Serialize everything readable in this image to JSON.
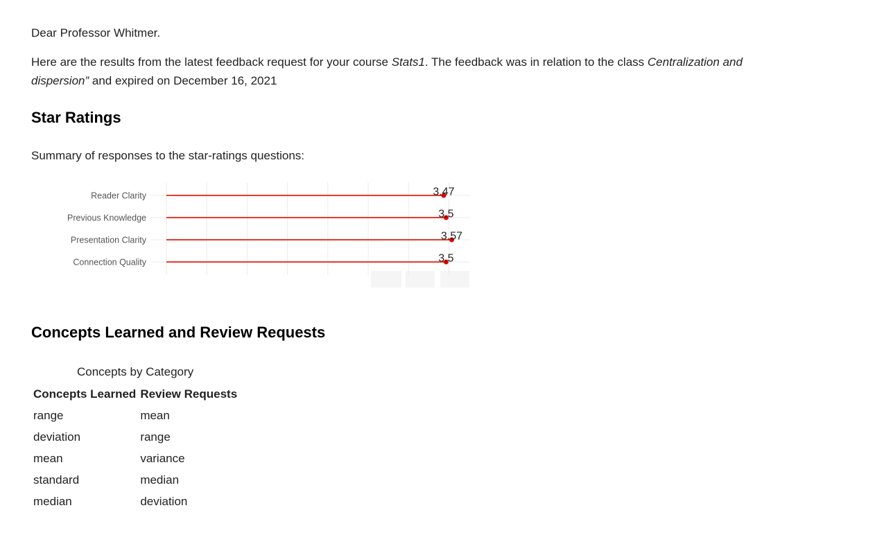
{
  "email": {
    "greeting": "Dear Professor Whitmer.",
    "intro": {
      "part1": "Here are the results from the latest feedback request for your course ",
      "course": "Stats1",
      "part2": ". The feedback was in relation to the class ",
      "class_name": "Centralization and dispersion”",
      "part3": " and expired on December 16, 2021"
    }
  },
  "star_ratings": {
    "heading": "Star Ratings",
    "summary": "Summary of responses to the star-ratings questions:"
  },
  "chart_data": {
    "type": "lollipop",
    "categories": [
      "Reader Clarity",
      "Previous Knowledge",
      "Presentation Clarity",
      "Connection Quality"
    ],
    "values": [
      3.47,
      3.5,
      3.57,
      3.5
    ],
    "labels": [
      "3.47",
      "3.5",
      "3.57",
      "3.5"
    ],
    "xlim": [
      0,
      3.8
    ],
    "color": "#e8392b",
    "grid": true
  },
  "concepts": {
    "heading": "Concepts Learned and Review Requests",
    "caption": "Concepts by Category",
    "columns": [
      "Concepts Learned",
      "Review Requests"
    ],
    "rows": [
      [
        "range",
        "mean"
      ],
      [
        "deviation",
        "range"
      ],
      [
        "mean",
        "variance"
      ],
      [
        "standard",
        "median"
      ],
      [
        "median",
        "deviation"
      ]
    ]
  }
}
